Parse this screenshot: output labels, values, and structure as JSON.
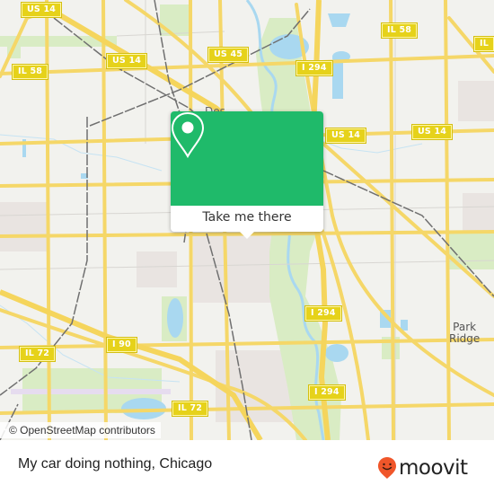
{
  "map": {
    "road_shields": [
      {
        "id": "us14-nw",
        "label": "US 14"
      },
      {
        "id": "us14-mid",
        "label": "US 14"
      },
      {
        "id": "il58-w",
        "label": "IL 58"
      },
      {
        "id": "us45",
        "label": "US 45"
      },
      {
        "id": "il58-ne",
        "label": "IL 58"
      },
      {
        "id": "il-edge",
        "label": "IL"
      },
      {
        "id": "i294-n",
        "label": "I 294"
      },
      {
        "id": "us14-e1",
        "label": "US 14"
      },
      {
        "id": "us14-e2",
        "label": "US 14"
      },
      {
        "id": "i294-mid",
        "label": "I 294"
      },
      {
        "id": "i294-s",
        "label": "I 294"
      },
      {
        "id": "i90",
        "label": "I 90"
      },
      {
        "id": "il72-w",
        "label": "IL 72"
      },
      {
        "id": "il72-s",
        "label": "IL 72"
      }
    ],
    "place_labels": {
      "park_ridge": "Park\nRidge",
      "des_plaines_partial": "Des"
    },
    "attribution": "© OpenStreetMap contributors",
    "colors": {
      "land": "#f2f2ee",
      "road": "#f7e06b",
      "park": "#d9ecc4",
      "water": "#a9d8f0",
      "urban": "#e8e3e0",
      "rail": "#707070"
    }
  },
  "popup": {
    "pin_icon": "location-pin-icon",
    "button_label": "Take me there",
    "accent": "#1fba6a"
  },
  "footer": {
    "title": "My car doing nothing, Chicago",
    "brand": "moovit",
    "brand_color": "#f0562a"
  }
}
